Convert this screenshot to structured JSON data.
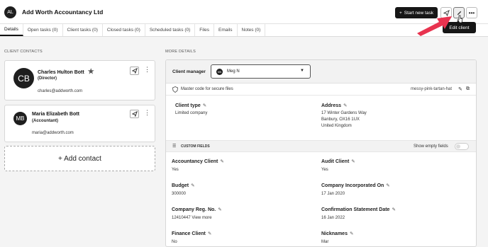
{
  "header": {
    "avatar_initials": "AL",
    "client_name": "Add Worth Accountancy Ltd",
    "start_task_label": "Start new task",
    "edit_tooltip": "Edit client"
  },
  "tabs": [
    {
      "label": "Details"
    },
    {
      "label": "Open tasks (0)"
    },
    {
      "label": "Client tasks (0)"
    },
    {
      "label": "Closed tasks (0)"
    },
    {
      "label": "Scheduled tasks (0)"
    },
    {
      "label": "Files"
    },
    {
      "label": "Emails"
    },
    {
      "label": "Notes (0)"
    }
  ],
  "contacts_section": {
    "heading": "CLIENT CONTACTS",
    "contacts": [
      {
        "initials": "CB",
        "name": "Charles Hulton Bott",
        "role": "(Director)",
        "email": "charles@addworth.com"
      },
      {
        "initials": "MB",
        "name": "Maria Elizabeth Bott",
        "role": "(Accountant)",
        "email": "maria@addworth.com"
      }
    ],
    "add_label": "+ Add contact"
  },
  "details_section": {
    "heading": "MORE DETAILS",
    "manager_label": "Client manager",
    "manager_initials": "MN",
    "manager_value": "Meg N",
    "master_code_label": "Master code for secure files",
    "master_code_value": "messy-pink-tartan-hat",
    "client_type_label": "Client type",
    "client_type_value": "Limited company",
    "address_label": "Address",
    "address_line1": "17 Winter Gardens Way",
    "address_line2": "Banbury, OX16 1UX",
    "address_line3": "United Kingdom",
    "custom_fields_label": "CUSTOM FIELDS",
    "show_empty_label": "Show empty fields",
    "fields": [
      {
        "label": "Accountancy Client",
        "value": "Yes"
      },
      {
        "label": "Audit Client",
        "value": "Yes"
      },
      {
        "label": "Budget",
        "value": "300000"
      },
      {
        "label": "Company Incorporated On",
        "value": "17 Jan 2020"
      },
      {
        "label": "Company Reg. No.",
        "value": "12410447 View more"
      },
      {
        "label": "Confirmation Statement Date",
        "value": "16 Jan 2022"
      },
      {
        "label": "Finance Client",
        "value": "No"
      },
      {
        "label": "Nicknames",
        "value": "Mar"
      }
    ]
  },
  "colors": {
    "primary_button": "#161616",
    "annotation_arrow": "#e8334f",
    "page_background": "#f4f4f4"
  }
}
